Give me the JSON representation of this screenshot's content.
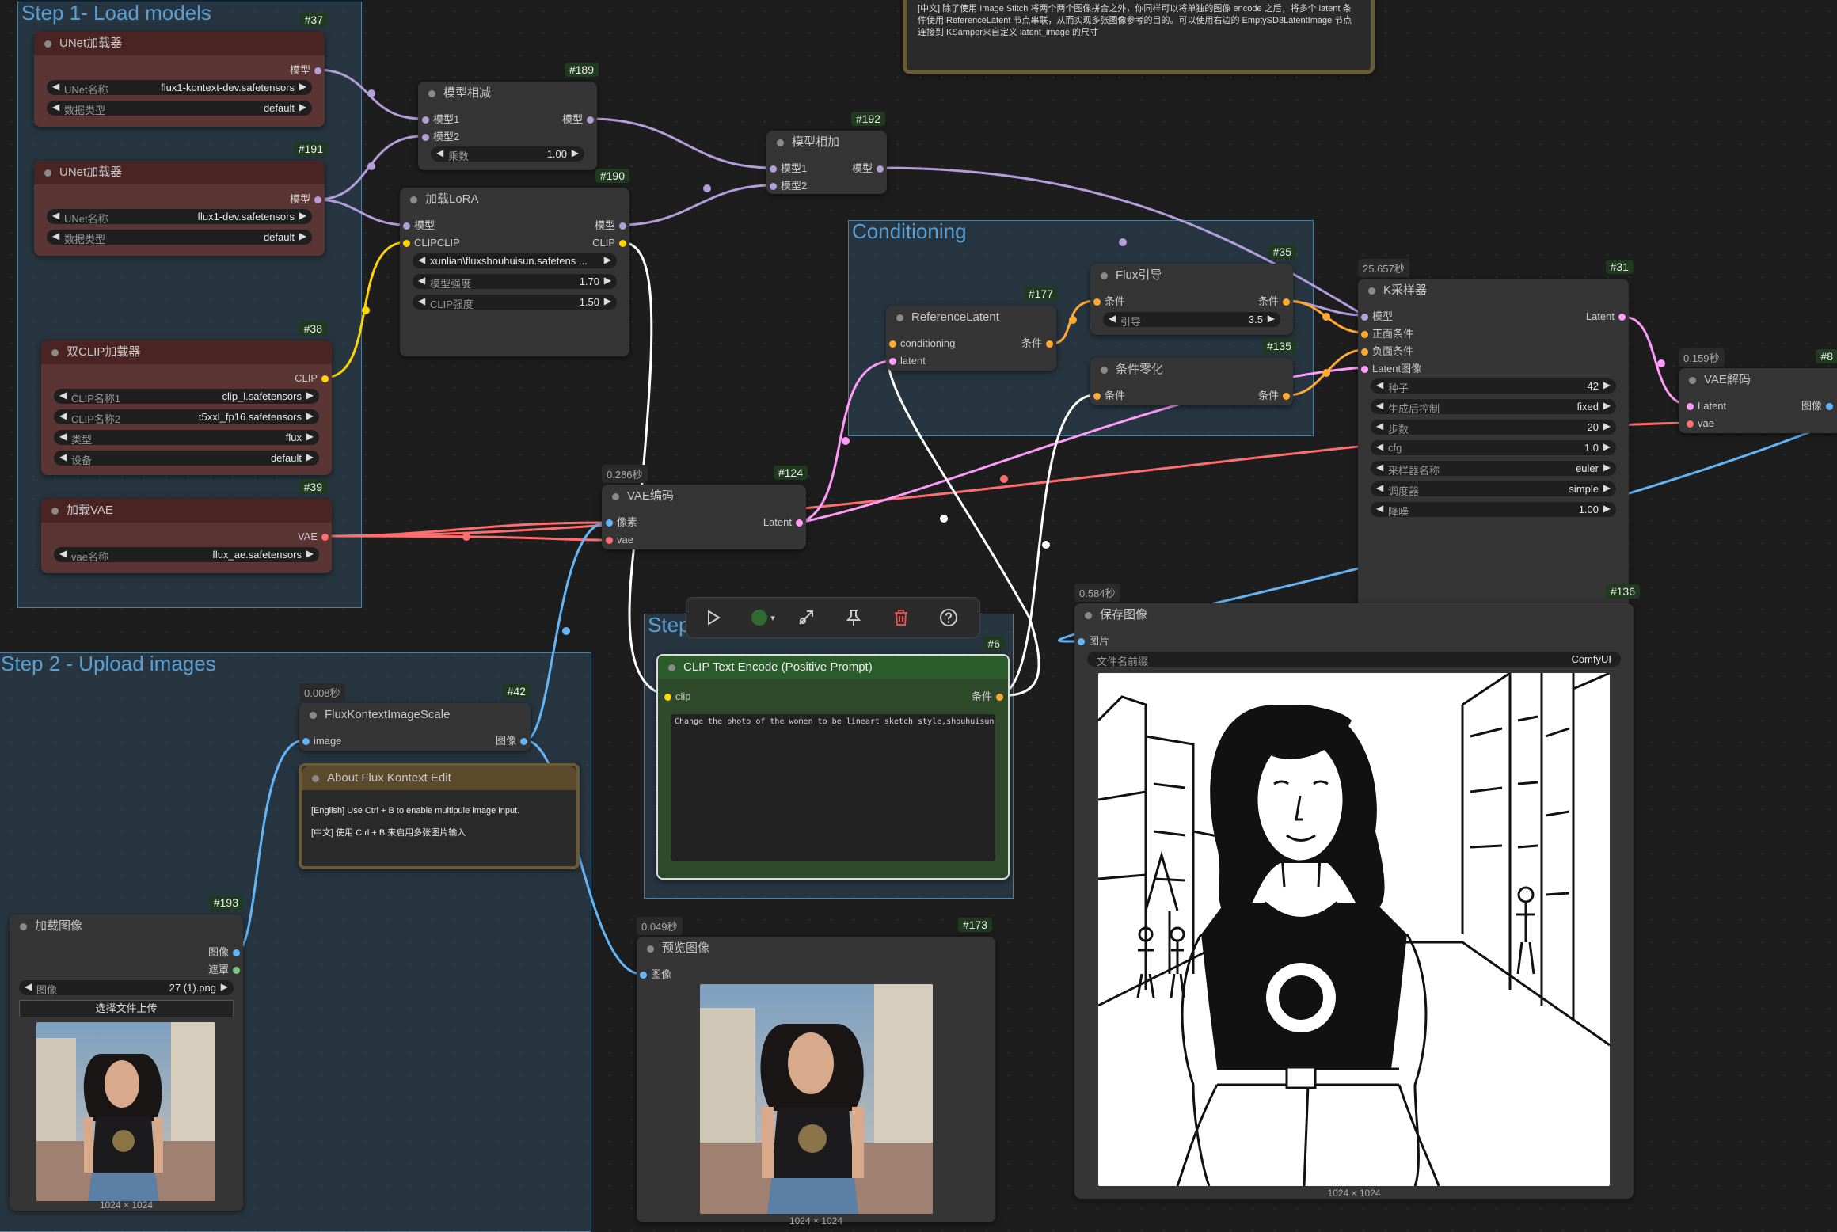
{
  "groups": {
    "g1": "Step 1- Load models",
    "g2": "Step 2 - Upload images",
    "g3": "Conditioning",
    "g4": "Step"
  },
  "note_top": "[中文] 除了使用 Image Stitch 将两个两个图像拼合之外，你同样可以将单独的图像 encode 之后，将多个 latent 条件使用 ReferenceLatent 节点串联，从而实现多张图像参考的目的。可以使用右边的 EmptySD3LatentImage 节点连接到 KSamper来自定义 latent_image 的尺寸",
  "nodes": {
    "unet37": {
      "id": "#37",
      "title": "UNet加载器",
      "out": "模型",
      "w1_label": "UNet名称",
      "w1_value": "flux1-kontext-dev.safetensors",
      "w2_label": "数据类型",
      "w2_value": "default"
    },
    "unet191": {
      "id": "#191",
      "title": "UNet加载器",
      "out": "模型",
      "w1_label": "UNet名称",
      "w1_value": "flux1-dev.safetensors",
      "w2_label": "数据类型",
      "w2_value": "default"
    },
    "sub189": {
      "id": "#189",
      "title": "模型相减",
      "in1": "模型1",
      "in2": "模型2",
      "out": "模型",
      "w_label": "乘数",
      "w_value": "1.00"
    },
    "lora190": {
      "id": "#190",
      "title": "加载LoRA",
      "in1": "模型",
      "in2": "CLIPCLIP",
      "out1": "模型",
      "out2": "CLIP",
      "w1_value": "xunlian\\fluxshouhuisun.safetens ...",
      "w2_label": "模型强度",
      "w2_value": "1.70",
      "w3_label": "CLIP强度",
      "w3_value": "1.50"
    },
    "add192": {
      "id": "#192",
      "title": "模型相加",
      "in1": "模型1",
      "in2": "模型2",
      "out": "模型"
    },
    "clip38": {
      "id": "#38",
      "title": "双CLIP加载器",
      "out": "CLIP",
      "w1_label": "CLIP名称1",
      "w1_value": "clip_l.safetensors",
      "w2_label": "CLIP名称2",
      "w2_value": "t5xxl_fp16.safetensors",
      "w3_label": "类型",
      "w3_value": "flux",
      "w4_label": "设备",
      "w4_value": "default"
    },
    "vae39": {
      "id": "#39",
      "title": "加载VAE",
      "out": "VAE",
      "w_label": "vae名称",
      "w_value": "flux_ae.safetensors"
    },
    "vaeenc124": {
      "id": "#124",
      "timer": "0.286秒",
      "title": "VAE编码",
      "in1": "像素",
      "in2": "vae",
      "out": "Latent"
    },
    "ref177": {
      "id": "#177",
      "title": "ReferenceLatent",
      "in1": "conditioning",
      "in2": "latent",
      "out": "条件"
    },
    "flux35": {
      "id": "#35",
      "title": "Flux引导",
      "in": "条件",
      "out": "条件",
      "w_label": "引导",
      "w_value": "3.5"
    },
    "zero135": {
      "id": "#135",
      "title": "条件零化",
      "in": "条件",
      "out": "条件"
    },
    "ks31": {
      "id": "#31",
      "timer": "25.657秒",
      "title": "K采样器",
      "in1": "模型",
      "in2": "正面条件",
      "in3": "负面条件",
      "in4": "Latent图像",
      "out": "Latent",
      "widgets": [
        {
          "label": "种子",
          "value": "42"
        },
        {
          "label": "生成后控制",
          "value": "fixed"
        },
        {
          "label": "步数",
          "value": "20"
        },
        {
          "label": "cfg",
          "value": "1.0"
        },
        {
          "label": "采样器名称",
          "value": "euler"
        },
        {
          "label": "调度器",
          "value": "simple"
        },
        {
          "label": "降噪",
          "value": "1.00"
        }
      ]
    },
    "vaedec8": {
      "id": "#8",
      "timer": "0.159秒",
      "title": "VAE解码",
      "in1": "Latent",
      "in2": "vae",
      "out": "图像"
    },
    "save136": {
      "id": "#136",
      "timer": "0.584秒",
      "title": "保存图像",
      "in": "图片",
      "w_label": "文件名前缀",
      "w_value": "ComfyUI",
      "caption": "1024 × 1024"
    },
    "clip6": {
      "id": "#6",
      "title": "CLIP Text Encode (Positive Prompt)",
      "in": "clip",
      "out": "条件",
      "text": "Change the photo of the women to be lineart sketch style,shouhuisun"
    },
    "scale42": {
      "id": "#42",
      "timer": "0.008秒",
      "title": "FluxKontextImageScale",
      "in": "image",
      "out": "图像"
    },
    "about": {
      "title": "About Flux Kontext Edit",
      "line1": "[English] Use Ctrl + B to enable multipule image input.",
      "line2": "[中文] 使用 Ctrl + B 来启用多张图片输入"
    },
    "load193": {
      "id": "#193",
      "title": "加载图像",
      "out1": "图像",
      "out2": "遮罩",
      "w_label": "图像",
      "w_value": "27 (1).png",
      "upload": "选择文件上传",
      "caption": "1024 × 1024"
    },
    "preview173": {
      "id": "#173",
      "timer": "0.049秒",
      "title": "预览图像",
      "in": "图像",
      "caption": "1024 × 1024"
    }
  },
  "colors": {
    "model": "#b39ddb",
    "clip": "#ffd500",
    "vae": "#ff6e6e",
    "latent": "#ff9cf9",
    "conditioning": "#ffa931",
    "image": "#64b5f6",
    "mask": "#81c784",
    "prompt_link": "#ffffff"
  }
}
